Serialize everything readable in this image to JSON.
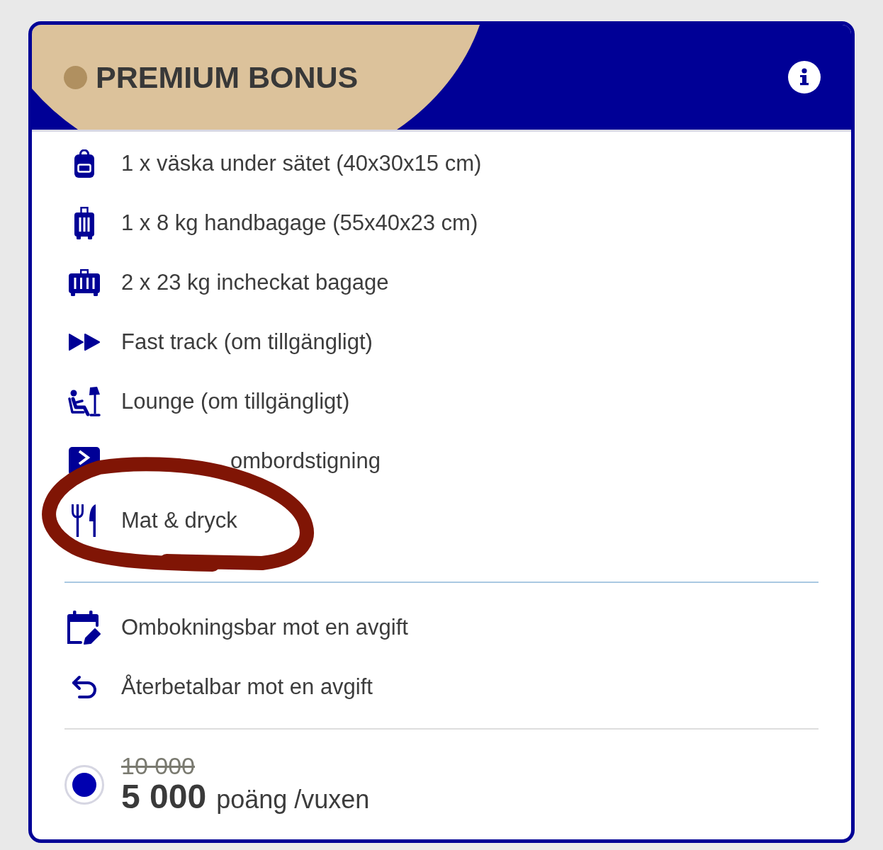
{
  "card": {
    "title": "PREMIUM BONUS"
  },
  "sections": [
    {
      "items": [
        {
          "kind": "bag",
          "text": "1 x väska under sätet (40x30x15 cm)",
          "covered": false,
          "circled": false
        },
        {
          "kind": "cabin",
          "text": "1 x 8 kg handbagage (55x40x23 cm)",
          "covered": false,
          "circled": false
        },
        {
          "kind": "checked",
          "text": "2 x 23 kg incheckat bagage",
          "covered": false,
          "circled": false
        },
        {
          "kind": "fasttrack",
          "text": "Fast track (om tillgängligt)",
          "covered": false,
          "circled": false
        },
        {
          "kind": "lounge",
          "text": "Lounge (om tillgängligt)",
          "covered": false,
          "circled": false
        },
        {
          "kind": "boarding",
          "text": "ombordstigning",
          "covered": true,
          "circled": false
        },
        {
          "kind": "meal",
          "text": "Mat & dryck",
          "covered": false,
          "circled": true
        }
      ]
    },
    {
      "items": [
        {
          "kind": "rebook",
          "text": "Ombokningsbar mot en avgift",
          "covered": false,
          "circled": false
        },
        {
          "kind": "refund",
          "text": "Återbetalbar mot en avgift",
          "covered": false,
          "circled": false
        }
      ]
    }
  ],
  "price": {
    "selected": true,
    "old": "10 000",
    "amount": "5 000",
    "unit": "poäng /vuxen"
  }
}
